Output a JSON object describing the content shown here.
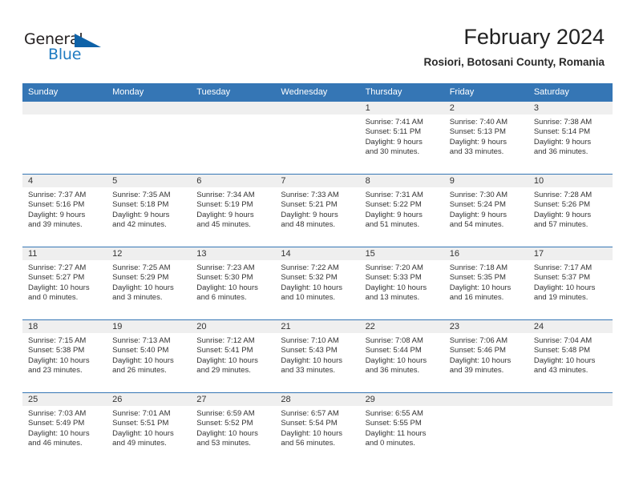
{
  "brand": {
    "name_part1": "General",
    "name_part2": "Blue",
    "triangle_color": "#0e62a8",
    "blue_color": "#1f7bc1"
  },
  "header": {
    "title": "February 2024",
    "subtitle": "Rosiori, Botosani County, Romania"
  },
  "colors": {
    "header_row_bg": "#3576b5",
    "daynum_band_bg": "#efefef",
    "text": "#333333"
  },
  "calendar": {
    "weekday_headers": [
      "Sunday",
      "Monday",
      "Tuesday",
      "Wednesday",
      "Thursday",
      "Friday",
      "Saturday"
    ],
    "weeks": [
      [
        {
          "blank": true
        },
        {
          "blank": true
        },
        {
          "blank": true
        },
        {
          "blank": true
        },
        {
          "day": "1",
          "sunrise": "Sunrise: 7:41 AM",
          "sunset": "Sunset: 5:11 PM",
          "daylight1": "Daylight: 9 hours",
          "daylight2": "and 30 minutes."
        },
        {
          "day": "2",
          "sunrise": "Sunrise: 7:40 AM",
          "sunset": "Sunset: 5:13 PM",
          "daylight1": "Daylight: 9 hours",
          "daylight2": "and 33 minutes."
        },
        {
          "day": "3",
          "sunrise": "Sunrise: 7:38 AM",
          "sunset": "Sunset: 5:14 PM",
          "daylight1": "Daylight: 9 hours",
          "daylight2": "and 36 minutes."
        }
      ],
      [
        {
          "day": "4",
          "sunrise": "Sunrise: 7:37 AM",
          "sunset": "Sunset: 5:16 PM",
          "daylight1": "Daylight: 9 hours",
          "daylight2": "and 39 minutes."
        },
        {
          "day": "5",
          "sunrise": "Sunrise: 7:35 AM",
          "sunset": "Sunset: 5:18 PM",
          "daylight1": "Daylight: 9 hours",
          "daylight2": "and 42 minutes."
        },
        {
          "day": "6",
          "sunrise": "Sunrise: 7:34 AM",
          "sunset": "Sunset: 5:19 PM",
          "daylight1": "Daylight: 9 hours",
          "daylight2": "and 45 minutes."
        },
        {
          "day": "7",
          "sunrise": "Sunrise: 7:33 AM",
          "sunset": "Sunset: 5:21 PM",
          "daylight1": "Daylight: 9 hours",
          "daylight2": "and 48 minutes."
        },
        {
          "day": "8",
          "sunrise": "Sunrise: 7:31 AM",
          "sunset": "Sunset: 5:22 PM",
          "daylight1": "Daylight: 9 hours",
          "daylight2": "and 51 minutes."
        },
        {
          "day": "9",
          "sunrise": "Sunrise: 7:30 AM",
          "sunset": "Sunset: 5:24 PM",
          "daylight1": "Daylight: 9 hours",
          "daylight2": "and 54 minutes."
        },
        {
          "day": "10",
          "sunrise": "Sunrise: 7:28 AM",
          "sunset": "Sunset: 5:26 PM",
          "daylight1": "Daylight: 9 hours",
          "daylight2": "and 57 minutes."
        }
      ],
      [
        {
          "day": "11",
          "sunrise": "Sunrise: 7:27 AM",
          "sunset": "Sunset: 5:27 PM",
          "daylight1": "Daylight: 10 hours",
          "daylight2": "and 0 minutes."
        },
        {
          "day": "12",
          "sunrise": "Sunrise: 7:25 AM",
          "sunset": "Sunset: 5:29 PM",
          "daylight1": "Daylight: 10 hours",
          "daylight2": "and 3 minutes."
        },
        {
          "day": "13",
          "sunrise": "Sunrise: 7:23 AM",
          "sunset": "Sunset: 5:30 PM",
          "daylight1": "Daylight: 10 hours",
          "daylight2": "and 6 minutes."
        },
        {
          "day": "14",
          "sunrise": "Sunrise: 7:22 AM",
          "sunset": "Sunset: 5:32 PM",
          "daylight1": "Daylight: 10 hours",
          "daylight2": "and 10 minutes."
        },
        {
          "day": "15",
          "sunrise": "Sunrise: 7:20 AM",
          "sunset": "Sunset: 5:33 PM",
          "daylight1": "Daylight: 10 hours",
          "daylight2": "and 13 minutes."
        },
        {
          "day": "16",
          "sunrise": "Sunrise: 7:18 AM",
          "sunset": "Sunset: 5:35 PM",
          "daylight1": "Daylight: 10 hours",
          "daylight2": "and 16 minutes."
        },
        {
          "day": "17",
          "sunrise": "Sunrise: 7:17 AM",
          "sunset": "Sunset: 5:37 PM",
          "daylight1": "Daylight: 10 hours",
          "daylight2": "and 19 minutes."
        }
      ],
      [
        {
          "day": "18",
          "sunrise": "Sunrise: 7:15 AM",
          "sunset": "Sunset: 5:38 PM",
          "daylight1": "Daylight: 10 hours",
          "daylight2": "and 23 minutes."
        },
        {
          "day": "19",
          "sunrise": "Sunrise: 7:13 AM",
          "sunset": "Sunset: 5:40 PM",
          "daylight1": "Daylight: 10 hours",
          "daylight2": "and 26 minutes."
        },
        {
          "day": "20",
          "sunrise": "Sunrise: 7:12 AM",
          "sunset": "Sunset: 5:41 PM",
          "daylight1": "Daylight: 10 hours",
          "daylight2": "and 29 minutes."
        },
        {
          "day": "21",
          "sunrise": "Sunrise: 7:10 AM",
          "sunset": "Sunset: 5:43 PM",
          "daylight1": "Daylight: 10 hours",
          "daylight2": "and 33 minutes."
        },
        {
          "day": "22",
          "sunrise": "Sunrise: 7:08 AM",
          "sunset": "Sunset: 5:44 PM",
          "daylight1": "Daylight: 10 hours",
          "daylight2": "and 36 minutes."
        },
        {
          "day": "23",
          "sunrise": "Sunrise: 7:06 AM",
          "sunset": "Sunset: 5:46 PM",
          "daylight1": "Daylight: 10 hours",
          "daylight2": "and 39 minutes."
        },
        {
          "day": "24",
          "sunrise": "Sunrise: 7:04 AM",
          "sunset": "Sunset: 5:48 PM",
          "daylight1": "Daylight: 10 hours",
          "daylight2": "and 43 minutes."
        }
      ],
      [
        {
          "day": "25",
          "sunrise": "Sunrise: 7:03 AM",
          "sunset": "Sunset: 5:49 PM",
          "daylight1": "Daylight: 10 hours",
          "daylight2": "and 46 minutes."
        },
        {
          "day": "26",
          "sunrise": "Sunrise: 7:01 AM",
          "sunset": "Sunset: 5:51 PM",
          "daylight1": "Daylight: 10 hours",
          "daylight2": "and 49 minutes."
        },
        {
          "day": "27",
          "sunrise": "Sunrise: 6:59 AM",
          "sunset": "Sunset: 5:52 PM",
          "daylight1": "Daylight: 10 hours",
          "daylight2": "and 53 minutes."
        },
        {
          "day": "28",
          "sunrise": "Sunrise: 6:57 AM",
          "sunset": "Sunset: 5:54 PM",
          "daylight1": "Daylight: 10 hours",
          "daylight2": "and 56 minutes."
        },
        {
          "day": "29",
          "sunrise": "Sunrise: 6:55 AM",
          "sunset": "Sunset: 5:55 PM",
          "daylight1": "Daylight: 11 hours",
          "daylight2": "and 0 minutes."
        },
        {
          "blank": true
        },
        {
          "blank": true
        }
      ]
    ]
  }
}
